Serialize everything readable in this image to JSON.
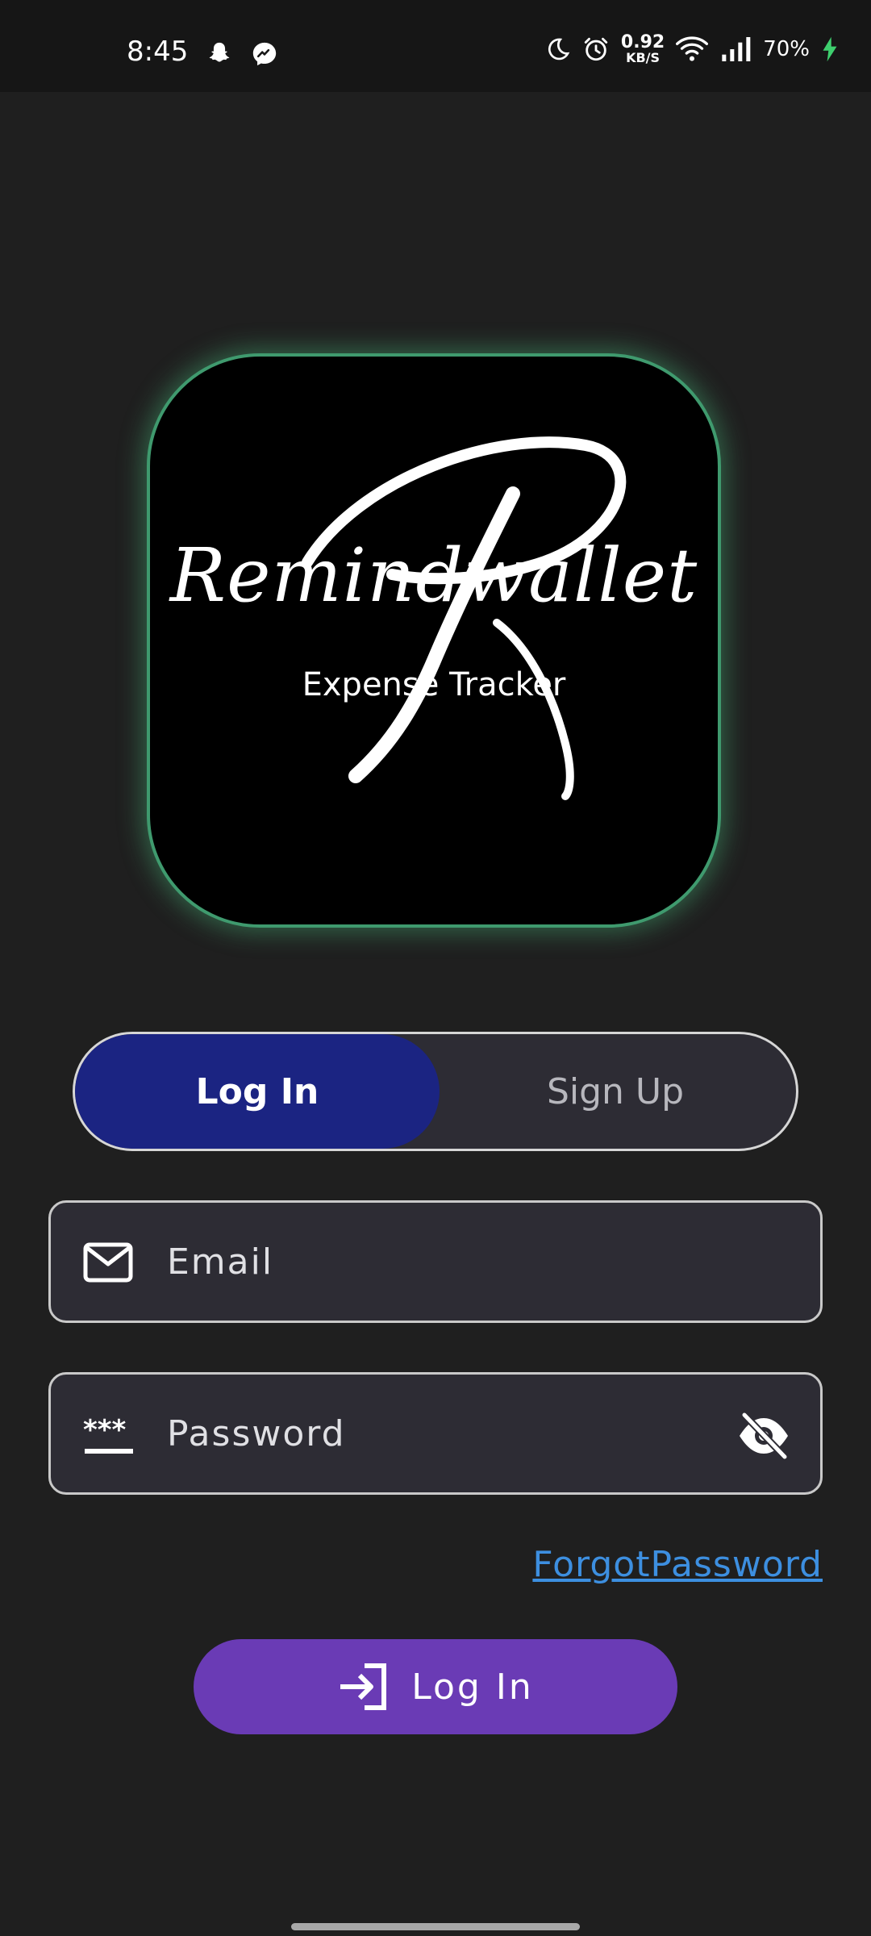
{
  "status_bar": {
    "time": "8:45",
    "left_icons": [
      "snapchat-icon",
      "messenger-icon"
    ],
    "right_icons": [
      "do-not-disturb-icon",
      "alarm-icon",
      "wifi-icon",
      "signal-icon",
      "battery-charging-icon"
    ],
    "net_speed_value": "0.92",
    "net_speed_unit": "KB/S",
    "battery_percent": "70%"
  },
  "logo": {
    "title": "Remindwallet",
    "subtitle": "Expense Tracker",
    "glow_color": "#3f9a6e"
  },
  "segmented_control": {
    "login_label": "Log In",
    "signup_label": "Sign Up",
    "selected": "login",
    "selected_color": "#1b2482"
  },
  "form": {
    "email_placeholder": "Email",
    "password_placeholder": "Password",
    "email_icon": "mail-icon",
    "password_icon": "password-icon",
    "visibility_icon": "eye-off-icon"
  },
  "forgot_password_label": "ForgotPassword",
  "login_button": {
    "label": "Log In",
    "icon": "login-arrow-icon",
    "color": "#6a3bb5"
  }
}
